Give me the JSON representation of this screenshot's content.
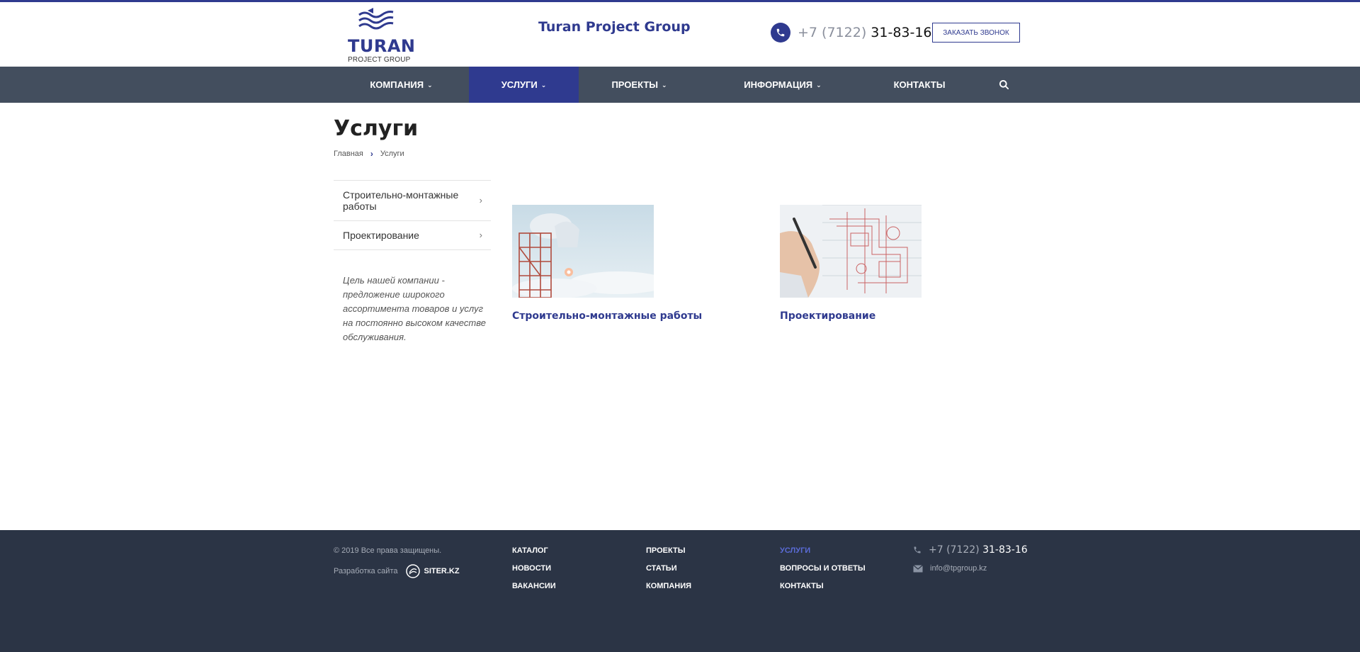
{
  "header": {
    "logo_brand": "TURAN",
    "logo_sub": "PROJECT GROUP",
    "site_title": "Turan Project Group",
    "phone_code": "+7 (7122)",
    "phone_number": "31-83-16",
    "callback_label": "ЗАКАЗАТЬ ЗВОНОК"
  },
  "nav": {
    "items": [
      {
        "label": "КОМПАНИЯ",
        "has_dropdown": true
      },
      {
        "label": "УСЛУГИ",
        "has_dropdown": true,
        "active": true
      },
      {
        "label": "ПРОЕКТЫ",
        "has_dropdown": true
      },
      {
        "label": "ИНФОРМАЦИЯ",
        "has_dropdown": true
      },
      {
        "label": "КОНТАКТЫ",
        "has_dropdown": false
      }
    ],
    "search_icon": "search-icon"
  },
  "page": {
    "title": "Услуги",
    "breadcrumb": [
      "Главная",
      "Услуги"
    ]
  },
  "sidebar": {
    "items": [
      {
        "label": "Строительно-монтажные работы"
      },
      {
        "label": "Проектирование"
      }
    ],
    "text": "Цель нашей компании - предложение широкого ассортимента товаров и услуг на постоянно высоком качестве обслуживания."
  },
  "services": [
    {
      "title": "Строительно-монтажные работы",
      "image": "construction-image"
    },
    {
      "title": "Проектирование",
      "image": "design-drawing-image"
    }
  ],
  "footer": {
    "copyright": "© 2019 Все права защищены.",
    "dev_label": "Разработка сайта",
    "dev_brand": "SITER.KZ",
    "col1": [
      "КАТАЛОГ",
      "НОВОСТИ",
      "ВАКАНСИИ"
    ],
    "col2": [
      "ПРОЕКТЫ",
      "СТАТЬИ",
      "КОМПАНИЯ"
    ],
    "col3": [
      "УСЛУГИ",
      "ВОПРОСЫ И ОТВЕТЫ",
      "КОНТАКТЫ"
    ],
    "phone_code": "+7 (7122)",
    "phone_number": "31-83-16",
    "email": "info@tpgroup.kz"
  },
  "colors": {
    "brand": "#2f3a8f",
    "nav_bg": "#434e5e",
    "footer_bg": "#2b3445"
  }
}
